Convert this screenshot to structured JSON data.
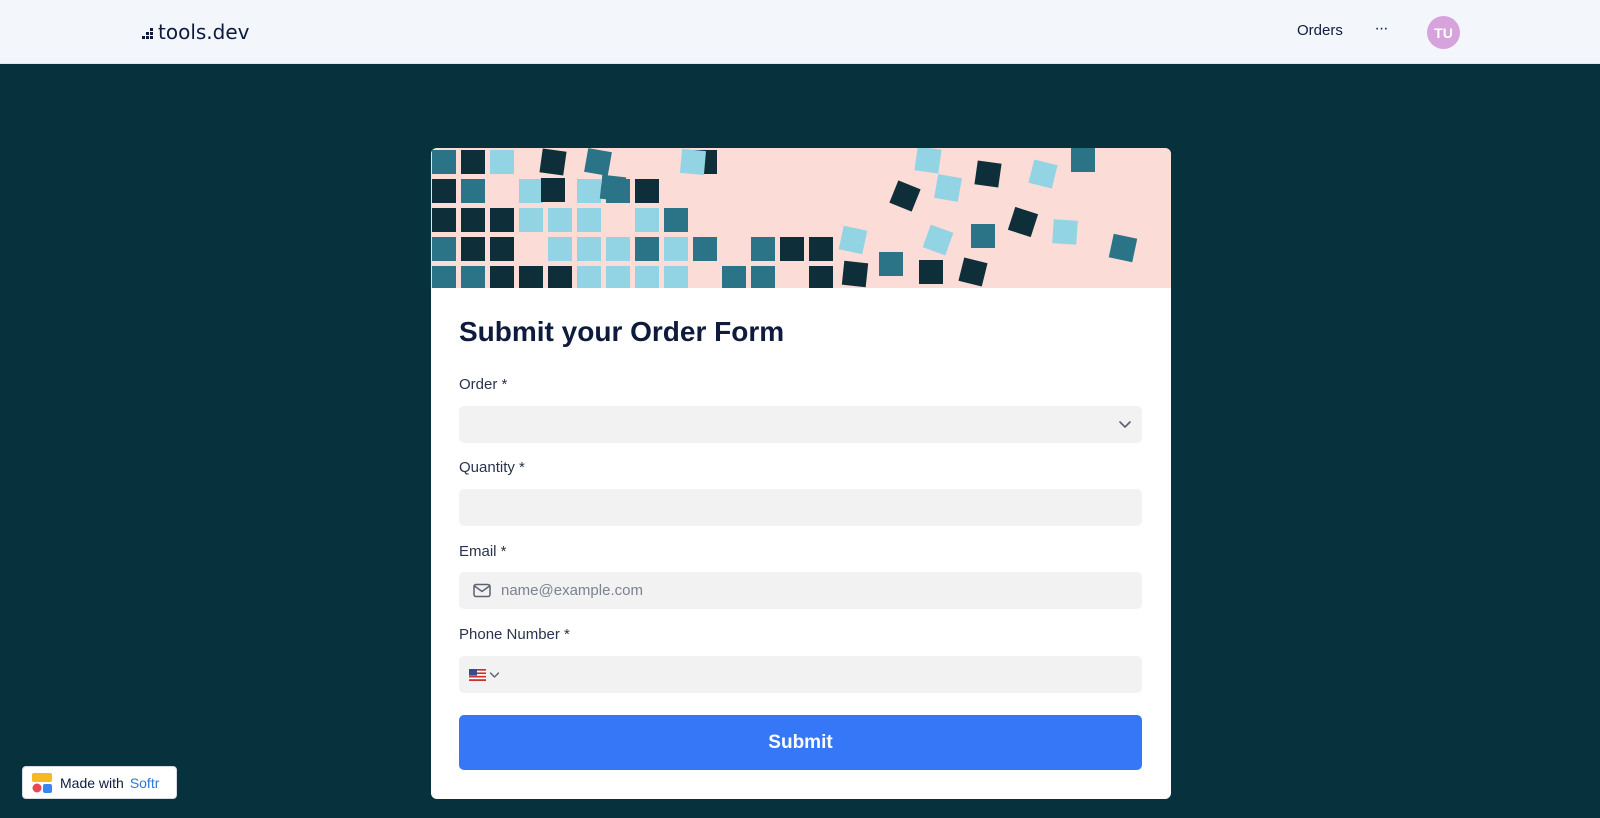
{
  "header": {
    "logo_text": "tools.dev",
    "nav_orders": "Orders",
    "more_glyph": "···",
    "avatar_initials": "TU",
    "avatar_color": "#d6a3dc"
  },
  "form": {
    "title": "Submit your Order Form",
    "order_label": "Order *",
    "order_value": "",
    "quantity_label": "Quantity *",
    "quantity_value": "",
    "email_label": "Email *",
    "email_placeholder": "name@example.com",
    "phone_label": "Phone Number *",
    "phone_country_flag": "us-flag-icon",
    "submit_label": "Submit"
  },
  "badge": {
    "made_with": "Made with",
    "brand": "Softr"
  },
  "colors": {
    "page_bg": "#07323d",
    "topbar_bg": "#f3f7fc",
    "banner_bg": "#fbdcd6",
    "submit_bg": "#3577f6",
    "field_bg": "#f2f2f2",
    "tile_dark": "#0e2f3a",
    "tile_teal": "#2b7386",
    "tile_light": "#92d3e4"
  }
}
